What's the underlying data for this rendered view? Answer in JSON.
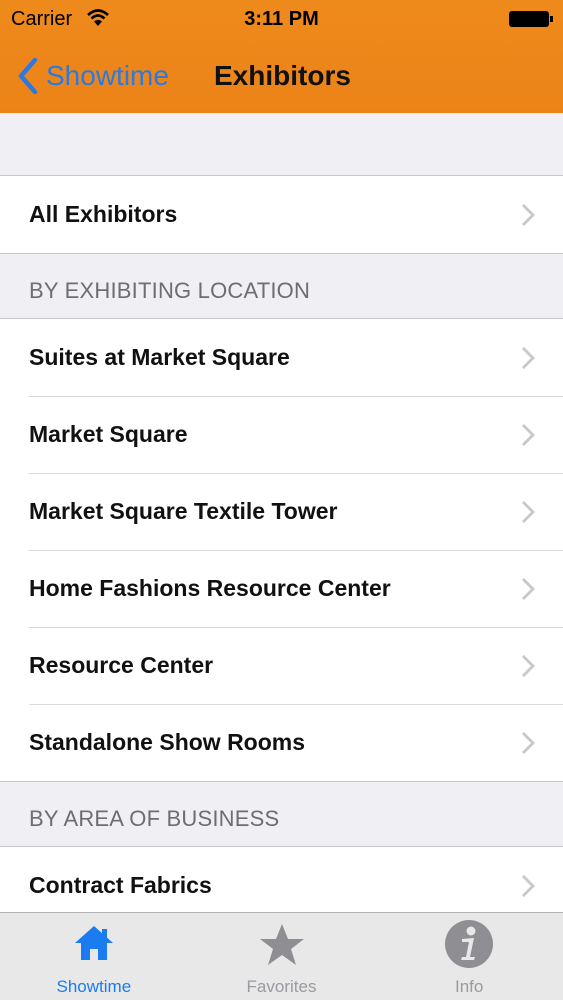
{
  "status_bar": {
    "carrier": "Carrier",
    "time": "3:11 PM"
  },
  "nav": {
    "back_label": "Showtime",
    "title": "Exhibitors"
  },
  "sections": {
    "all_row": "All Exhibitors",
    "location_header": "BY EXHIBITING LOCATION",
    "location_items": [
      "Suites at Market Square",
      "Market Square",
      "Market Square Textile Tower",
      "Home Fashions Resource Center",
      "Resource Center",
      "Standalone Show Rooms"
    ],
    "business_header": "BY AREA OF BUSINESS",
    "business_items": [
      "Contract Fabrics"
    ]
  },
  "tabs": [
    {
      "label": "Showtime",
      "icon": "home-icon",
      "active": true
    },
    {
      "label": "Favorites",
      "icon": "star-icon",
      "active": false
    },
    {
      "label": "Info",
      "icon": "info-icon",
      "active": false
    }
  ],
  "colors": {
    "accent": "#ec8318",
    "tint": "#2a7ae2",
    "inactive_tab": "#8e8e93"
  }
}
